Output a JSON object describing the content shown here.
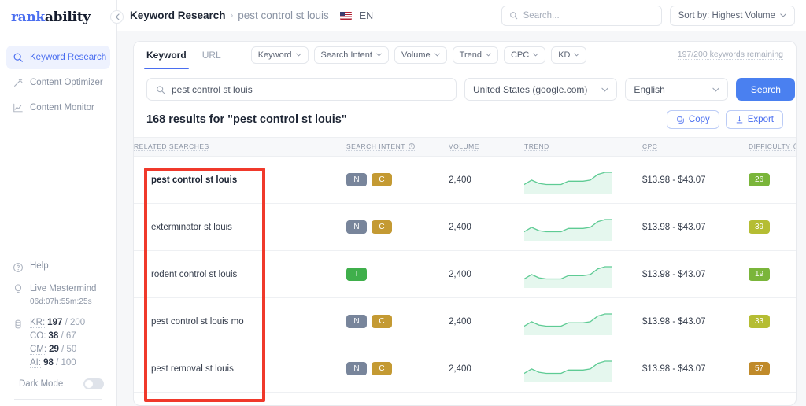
{
  "brand": {
    "part1": "rank",
    "part2": "ability"
  },
  "sidebar": {
    "nav": [
      {
        "label": "Keyword Research",
        "icon": "search-icon",
        "active": true
      },
      {
        "label": "Content Optimizer",
        "icon": "magic-wand-icon",
        "active": false
      },
      {
        "label": "Content Monitor",
        "icon": "line-chart-icon",
        "active": false
      }
    ],
    "help_label": "Help",
    "mastermind_label": "Live Mastermind",
    "mastermind_timer": "06d:07h:55m:25s",
    "quota": [
      {
        "label": "KR:",
        "value": "197",
        "total": "/ 200"
      },
      {
        "label": "CO:",
        "value": "38",
        "total": "/ 67"
      },
      {
        "label": "CM:",
        "value": "29",
        "total": "/ 50"
      },
      {
        "label": "AI:",
        "value": "98",
        "total": "/ 100"
      }
    ],
    "dark_mode_label": "Dark Mode",
    "dark_mode_on": false
  },
  "topbar": {
    "breadcrumb_root": "Keyword Research",
    "breadcrumb_sep": "›",
    "breadcrumb_current": "pest control st louis",
    "language_code": "EN",
    "search_placeholder": "Search...",
    "sort_label": "Sort by: Highest Volume"
  },
  "filters": {
    "tabs": [
      {
        "label": "Keyword",
        "active": true
      },
      {
        "label": "URL",
        "active": false
      }
    ],
    "chips": [
      "Keyword",
      "Search Intent",
      "Volume",
      "Trend",
      "CPC",
      "KD"
    ],
    "quota_note": "197/200 keywords remaining"
  },
  "search": {
    "keyword_value": "pest control st louis",
    "country": "United States (google.com)",
    "language": "English",
    "button_label": "Search"
  },
  "results": {
    "title": "168 results for \"pest control st louis\"",
    "copy_label": "Copy",
    "export_label": "Export"
  },
  "table": {
    "columns": [
      {
        "label": "RELATED SEARCHES",
        "info": false
      },
      {
        "label": "SEARCH INTENT",
        "info": true
      },
      {
        "label": "VOLUME",
        "info": false
      },
      {
        "label": "TREND",
        "info": false
      },
      {
        "label": "CPC",
        "info": false
      },
      {
        "label": "DIFFICULTY",
        "info": true
      }
    ],
    "rows": [
      {
        "keyword": "pest control st louis",
        "bold": true,
        "intents": [
          {
            "code": "N",
            "color": "#78859b"
          },
          {
            "code": "C",
            "color": "#c49a33"
          }
        ],
        "volume": "2,400",
        "cpc": "$13.98 - $43.07",
        "difficulty": "26",
        "difficulty_color": "#7ab53a"
      },
      {
        "keyword": "exterminator st louis",
        "bold": false,
        "intents": [
          {
            "code": "N",
            "color": "#78859b"
          },
          {
            "code": "C",
            "color": "#c49a33"
          }
        ],
        "volume": "2,400",
        "cpc": "$13.98 - $43.07",
        "difficulty": "39",
        "difficulty_color": "#b5bd33"
      },
      {
        "keyword": "rodent control st louis",
        "bold": false,
        "intents": [
          {
            "code": "T",
            "color": "#3faf4b"
          }
        ],
        "volume": "2,400",
        "cpc": "$13.98 - $43.07",
        "difficulty": "19",
        "difficulty_color": "#7ab53a"
      },
      {
        "keyword": "pest control st louis mo",
        "bold": false,
        "intents": [
          {
            "code": "N",
            "color": "#78859b"
          },
          {
            "code": "C",
            "color": "#c49a33"
          }
        ],
        "volume": "2,400",
        "cpc": "$13.98 - $43.07",
        "difficulty": "33",
        "difficulty_color": "#b5bd33"
      },
      {
        "keyword": "pest removal st louis",
        "bold": false,
        "intents": [
          {
            "code": "N",
            "color": "#78859b"
          },
          {
            "code": "C",
            "color": "#c49a33"
          }
        ],
        "volume": "2,400",
        "cpc": "$13.98 - $43.07",
        "difficulty": "57",
        "difficulty_color": "#c08a2a"
      }
    ],
    "trend_sparkline": [
      6,
      10,
      7,
      6,
      6,
      6,
      9,
      9,
      9,
      10,
      15,
      17,
      17
    ]
  },
  "colors": {
    "accent": "#4a6ef0",
    "search_button": "#4a80f0",
    "annotation_box": "#f0392b",
    "sparkline": "#5ecb94"
  }
}
